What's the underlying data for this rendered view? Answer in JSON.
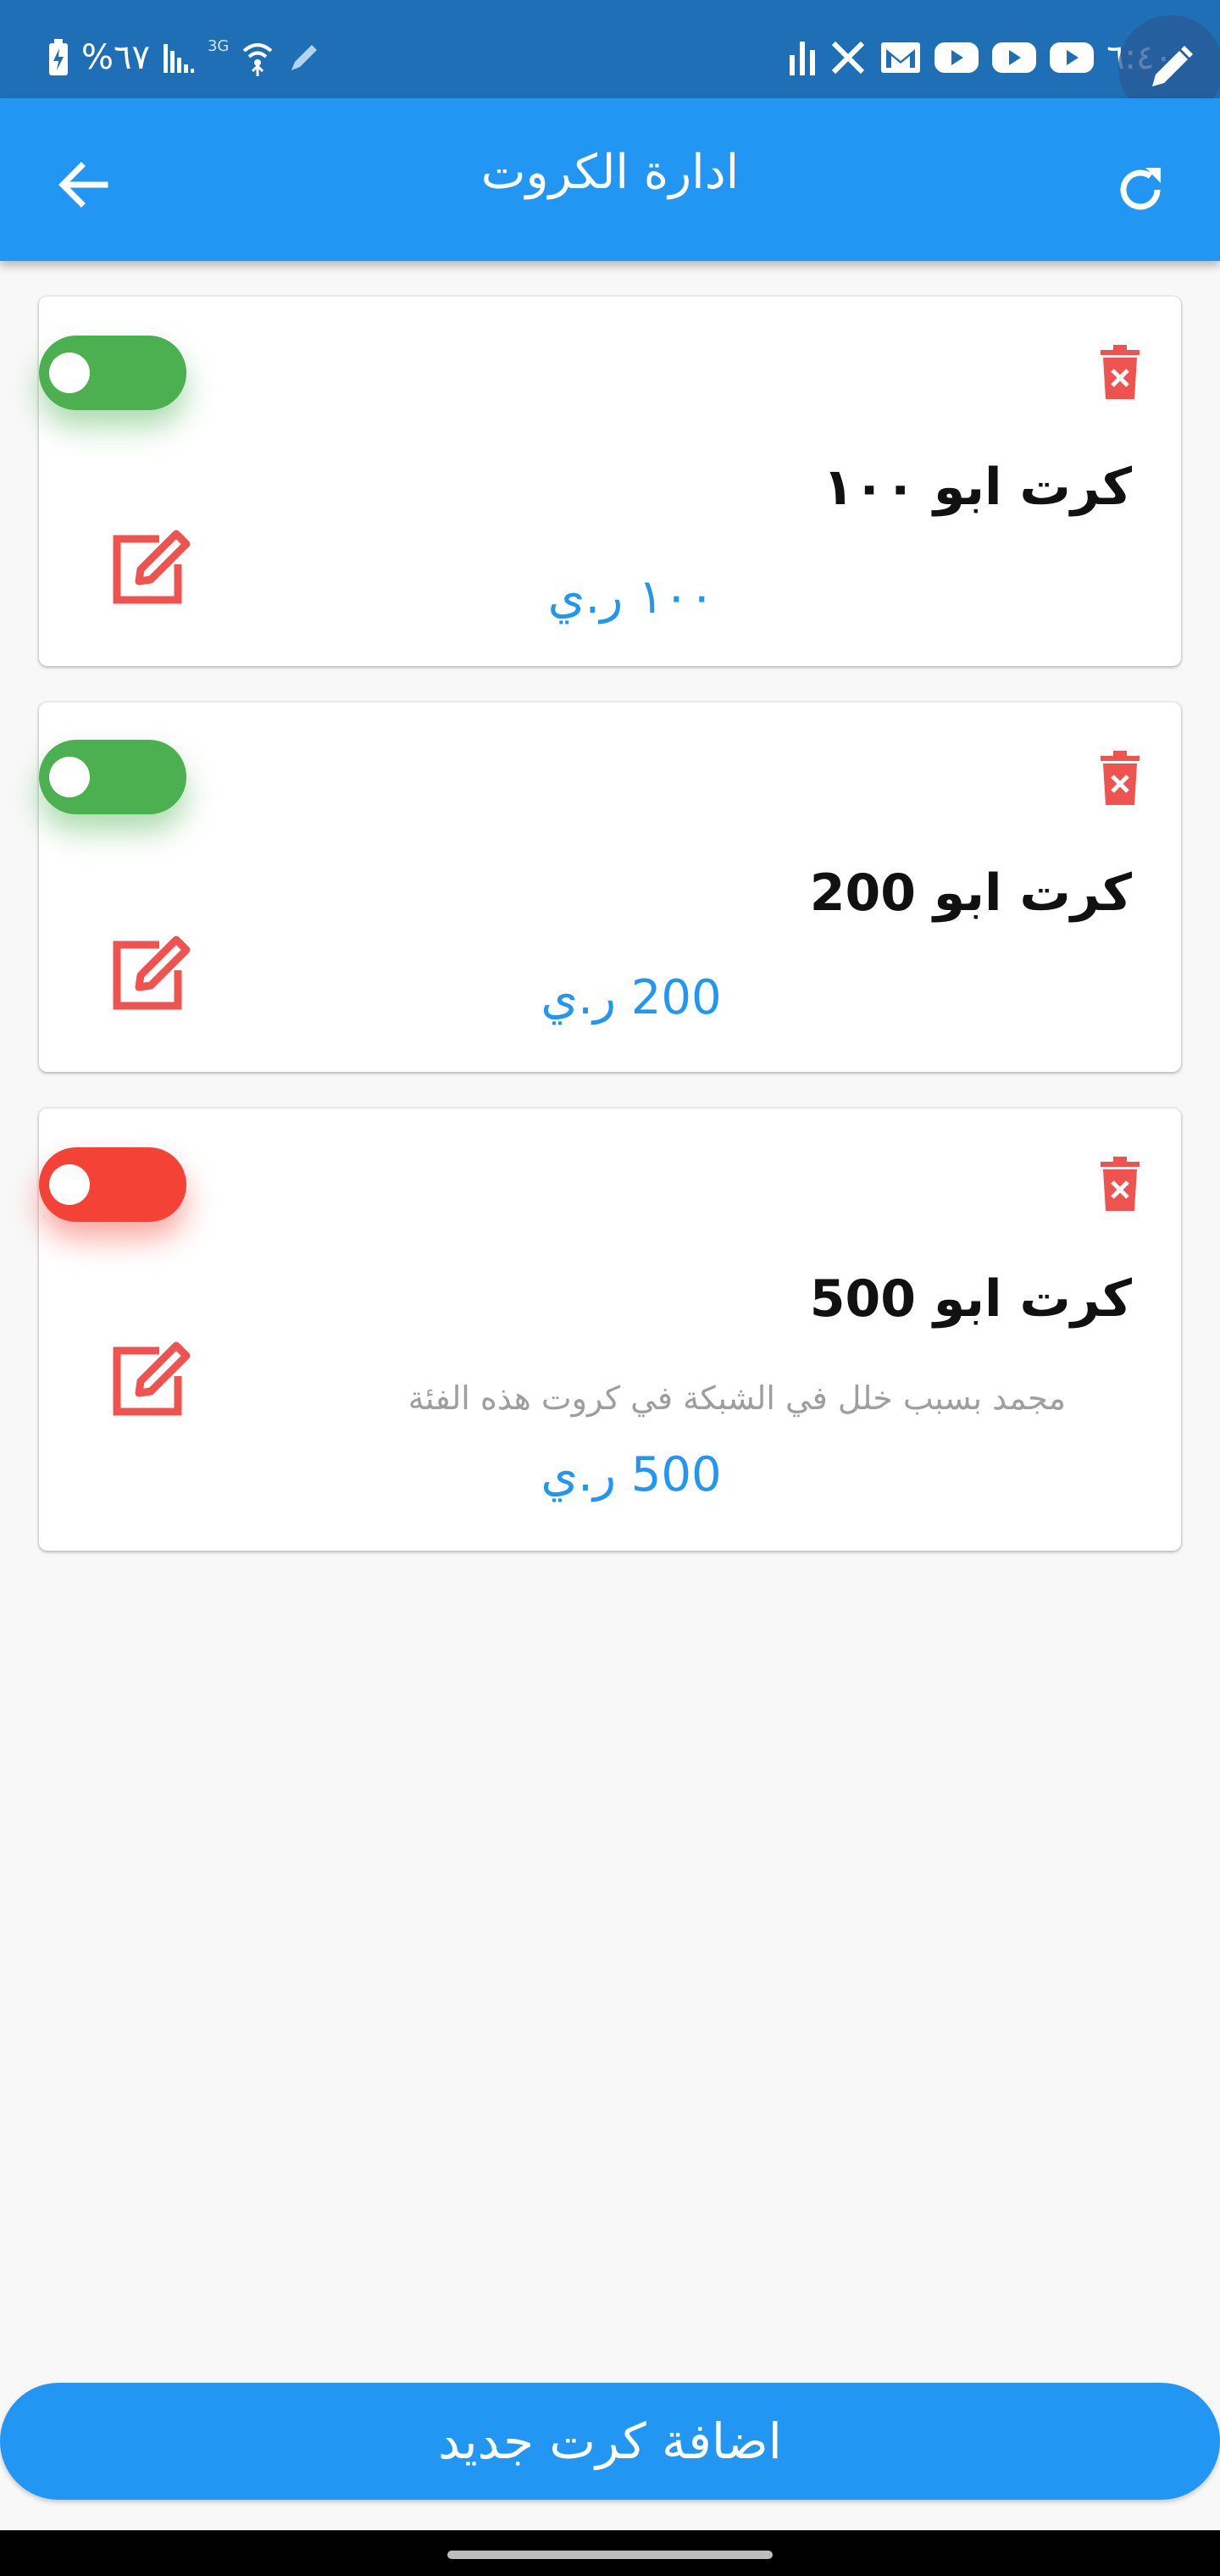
{
  "status_bar": {
    "time": "٦:٤٠",
    "battery": "%٦٧",
    "network_label": "3G"
  },
  "app_bar": {
    "title": "ادارة الكروت"
  },
  "cards": [
    {
      "title": "كرت ابو ١٠٠",
      "price": "١٠٠ ر.ي",
      "note": "",
      "enabled": true
    },
    {
      "title": "كرت ابو 200",
      "price": "200 ر.ي",
      "note": "",
      "enabled": true
    },
    {
      "title": "كرت ابو 500",
      "price": "500 ر.ي",
      "note": "مجمد بسبب خلل في الشبكة في كروت هذه الفئة",
      "enabled": false
    }
  ],
  "add_button": {
    "label": "اضافة كرت جديد"
  },
  "colors": {
    "primary": "#2196f3",
    "status_bar": "#1f6fb6",
    "enabled": "#4caf50",
    "disabled": "#f44336",
    "action_red": "#ef5350"
  },
  "icons": [
    "back-arrow-icon",
    "refresh-icon",
    "trash-icon",
    "edit-icon",
    "pencil-icon"
  ]
}
